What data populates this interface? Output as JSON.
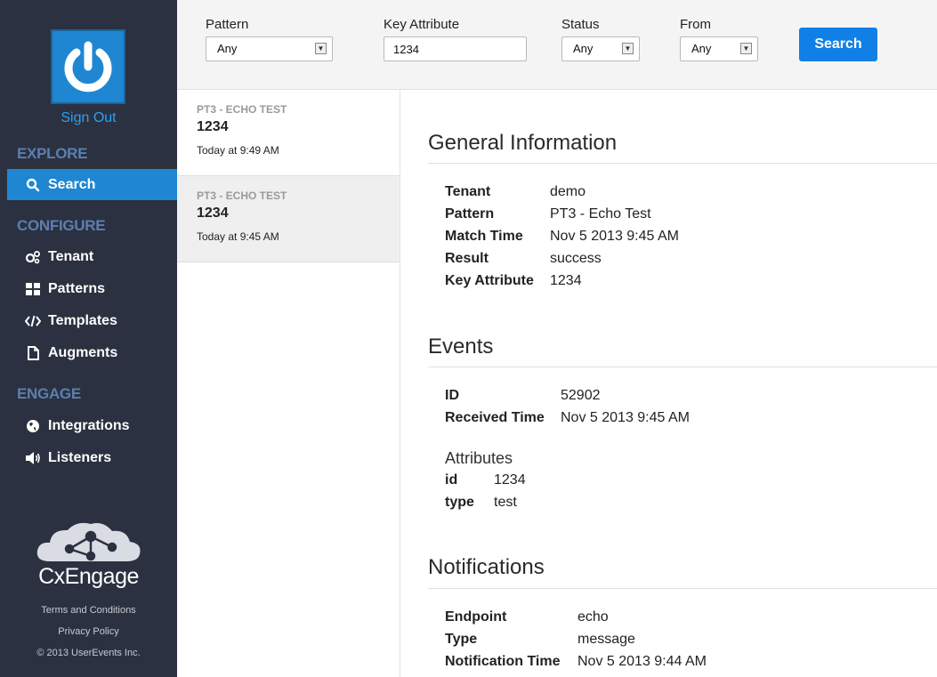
{
  "sidebar": {
    "sign_out": "Sign Out",
    "sections": {
      "explore": "EXPLORE",
      "configure": "CONFIGURE",
      "engage": "ENGAGE"
    },
    "items": {
      "search": "Search",
      "tenant": "Tenant",
      "patterns": "Patterns",
      "templates": "Templates",
      "augments": "Augments",
      "integrations": "Integrations",
      "listeners": "Listeners"
    },
    "brand": "CxEngage",
    "footer": {
      "terms": "Terms and Conditions",
      "privacy": "Privacy Policy",
      "copyright": "© 2013 UserEvents Inc."
    }
  },
  "filters": {
    "pattern": {
      "label": "Pattern",
      "value": "Any"
    },
    "key_attribute": {
      "label": "Key Attribute",
      "value": "1234"
    },
    "status": {
      "label": "Status",
      "value": "Any"
    },
    "from": {
      "label": "From",
      "value": "Any"
    },
    "search_button": "Search"
  },
  "results": [
    {
      "pattern": "PT3 - ECHO TEST",
      "key": "1234",
      "time": "Today at 9:49 AM",
      "selected": false
    },
    {
      "pattern": "PT3 - ECHO TEST",
      "key": "1234",
      "time": "Today at 9:45 AM",
      "selected": true
    }
  ],
  "detail": {
    "general": {
      "title": "General Information",
      "rows": [
        {
          "k": "Tenant",
          "v": "demo"
        },
        {
          "k": "Pattern",
          "v": "PT3 - Echo Test"
        },
        {
          "k": "Match Time",
          "v": "Nov 5 2013 9:45 AM"
        },
        {
          "k": "Result",
          "v": "success"
        },
        {
          "k": "Key Attribute",
          "v": "1234"
        }
      ]
    },
    "events": {
      "title": "Events",
      "rows": [
        {
          "k": "ID",
          "v": "52902"
        },
        {
          "k": "Received Time",
          "v": "Nov 5 2013 9:45 AM"
        }
      ],
      "attributes_title": "Attributes",
      "attributes": [
        {
          "k": "id",
          "v": "1234"
        },
        {
          "k": "type",
          "v": "test"
        }
      ]
    },
    "notifications": {
      "title": "Notifications",
      "rows": [
        {
          "k": "Endpoint",
          "v": "echo"
        },
        {
          "k": "Type",
          "v": "message"
        },
        {
          "k": "Notification Time",
          "v": "Nov 5 2013 9:44 AM"
        }
      ]
    }
  },
  "colors": {
    "sidebar": "#2b3140",
    "accent": "#1f87d2",
    "section_heading": "#5b7fb0",
    "button": "#1180e6"
  }
}
